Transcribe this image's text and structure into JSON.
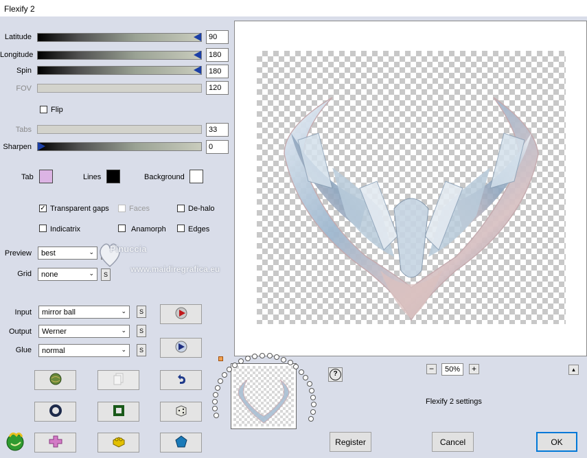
{
  "window": {
    "title": "Flexify 2"
  },
  "sliders": [
    {
      "label": "Latitude",
      "value": "90",
      "enabled": true,
      "fraction": 1.0
    },
    {
      "label": "Longitude",
      "value": "180",
      "enabled": true,
      "fraction": 1.0
    },
    {
      "label": "Spin",
      "value": "180",
      "enabled": true,
      "fraction": 1.0
    },
    {
      "label": "FOV",
      "value": "120",
      "enabled": false
    },
    {
      "label": "Tabs",
      "value": "33",
      "enabled": false
    },
    {
      "label": "Sharpen",
      "value": "0",
      "enabled": true,
      "fraction": 0.0
    }
  ],
  "flip": {
    "label": "Flip",
    "checked": false
  },
  "colors": {
    "tab": {
      "label": "Tab",
      "color": "#dcb4e4"
    },
    "lines": {
      "label": "Lines",
      "color": "#000000"
    },
    "background": {
      "label": "Background",
      "color": "#ffffff"
    }
  },
  "checkboxes": {
    "transparent_gaps": {
      "label": "Transparent gaps",
      "checked": true
    },
    "faces": {
      "label": "Faces",
      "checked": false,
      "enabled": false
    },
    "de_halo": {
      "label": "De-halo",
      "checked": false
    },
    "indicatrix": {
      "label": "Indicatrix",
      "checked": false
    },
    "anamorph": {
      "label": "Anamorph",
      "checked": false
    },
    "edges": {
      "label": "Edges",
      "checked": false
    }
  },
  "selects": {
    "preview": {
      "label": "Preview",
      "value": "best"
    },
    "grid": {
      "label": "Grid",
      "value": "none"
    },
    "input": {
      "label": "Input",
      "value": "mirror ball"
    },
    "output": {
      "label": "Output",
      "value": "Werner"
    },
    "glue": {
      "label": "Glue",
      "value": "normal"
    }
  },
  "s_label": "S",
  "watermark": {
    "line1": "Pinuccia",
    "line2": "www.maidiregrafica.eu"
  },
  "zoom": {
    "value": "50%",
    "minus": "−",
    "plus": "+"
  },
  "help": "?",
  "collapse": "▴",
  "settings_label": "Flexify 2 settings",
  "buttons": {
    "register": "Register",
    "cancel": "Cancel",
    "ok": "OK"
  },
  "icons": {
    "tool_row1": [
      "globe-icon",
      "copy-icon",
      "undo-icon"
    ],
    "tool_row2": [
      "ring-icon",
      "frame-icon",
      "dice-icon"
    ],
    "tool_row3": [
      "cross-icon",
      "brick-icon",
      "gem-icon"
    ],
    "side": [
      "play-icon",
      "bounce-icon"
    ],
    "logo": "flexify-logo-icon"
  }
}
